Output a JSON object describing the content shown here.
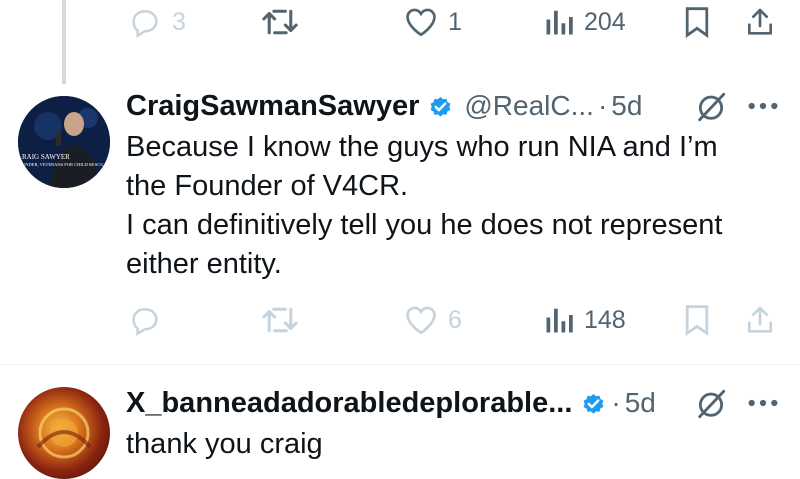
{
  "top_actions": {
    "replies": "3",
    "reposts": "",
    "likes": "1",
    "views": "204"
  },
  "tweets": [
    {
      "name": "CraigSawmanSawyer",
      "handle": "@RealC...",
      "separator": "·",
      "time": "5d",
      "avatar_caption": {
        "line1": "RAIG SAWYER",
        "line2": "UNDER, VETERANS FOR CHILD RESCU"
      },
      "text_lines": [
        "Because I know the guys who run NIA and I’m",
        "the Founder of V4CR.",
        "I can definitively tell you he does not represent",
        "either entity."
      ],
      "actions": {
        "replies": "",
        "reposts": "",
        "likes": "6",
        "views": "148"
      }
    },
    {
      "name": "X_banneadadorabledeplorable...",
      "separator": "·",
      "time": "5d",
      "text_lines": [
        "thank you craig"
      ]
    }
  ],
  "icons": {
    "reply": "speech-bubble-icon",
    "repost": "repost-arrows-icon",
    "like": "heart-icon",
    "views": "bar-chart-icon",
    "bookmark": "bookmark-icon",
    "share": "share-upload-icon",
    "verified": "verified-badge-icon",
    "grok": "grok-slash-circle-icon",
    "more": "ellipsis-icon"
  },
  "colors": {
    "text": "#0f1419",
    "muted": "#536471",
    "faded": "#c7d3dc",
    "verified": "#1d9bf0",
    "divider": "#eff3f4"
  }
}
